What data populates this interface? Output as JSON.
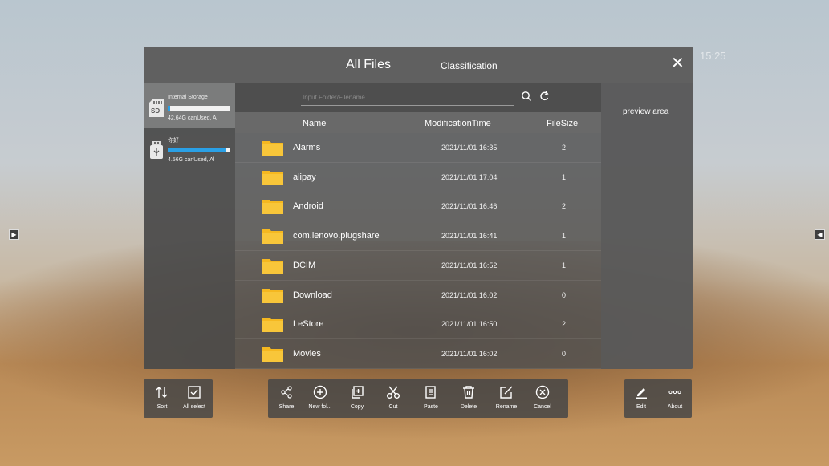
{
  "clock": "15:25",
  "window": {
    "title": "All Files",
    "classification_tab": "Classification",
    "close_icon": "close-icon"
  },
  "storage": [
    {
      "name": "Internal Storage",
      "capacity": "42.64G canUsed, Al",
      "used_fraction": 0.04,
      "icon": "sd-card-icon"
    },
    {
      "name": "你好",
      "capacity": "4.56G canUsed, Al",
      "used_fraction": 0.93,
      "icon": "usb-drive-icon"
    }
  ],
  "search": {
    "placeholder": "Input Folder/Filename"
  },
  "columns": {
    "name": "Name",
    "time": "ModificationTime",
    "size": "FileSize"
  },
  "files": [
    {
      "name": "Alarms",
      "time": "2021/11/01 16:35",
      "size": "2"
    },
    {
      "name": "alipay",
      "time": "2021/11/01 17:04",
      "size": "1"
    },
    {
      "name": "Android",
      "time": "2021/11/01 16:46",
      "size": "2"
    },
    {
      "name": "com.lenovo.plugshare",
      "time": "2021/11/01 16:41",
      "size": "1"
    },
    {
      "name": "DCIM",
      "time": "2021/11/01 16:52",
      "size": "1"
    },
    {
      "name": "Download",
      "time": "2021/11/01 16:02",
      "size": "0"
    },
    {
      "name": "LeStore",
      "time": "2021/11/01 16:50",
      "size": "2"
    },
    {
      "name": "Movies",
      "time": "2021/11/01 16:02",
      "size": "0"
    }
  ],
  "preview": {
    "label": "preview area"
  },
  "toolbar_left": [
    {
      "label": "Sort",
      "icon": "sort-icon"
    },
    {
      "label": "All select",
      "icon": "select-all-icon"
    }
  ],
  "toolbar_center": [
    {
      "label": "Share",
      "icon": "share-icon"
    },
    {
      "label": "New fol...",
      "icon": "new-folder-icon"
    },
    {
      "label": "Copy",
      "icon": "copy-icon"
    },
    {
      "label": "Cut",
      "icon": "cut-icon"
    },
    {
      "label": "Paste",
      "icon": "paste-icon"
    },
    {
      "label": "Delete",
      "icon": "delete-icon"
    },
    {
      "label": "Rename",
      "icon": "rename-icon"
    },
    {
      "label": "Cancel",
      "icon": "cancel-icon"
    }
  ],
  "toolbar_right": [
    {
      "label": "Edit",
      "icon": "edit-icon"
    },
    {
      "label": "About",
      "icon": "more-icon"
    }
  ],
  "colors": {
    "accent": "#2aa0e6",
    "folder": "#f5b820"
  }
}
